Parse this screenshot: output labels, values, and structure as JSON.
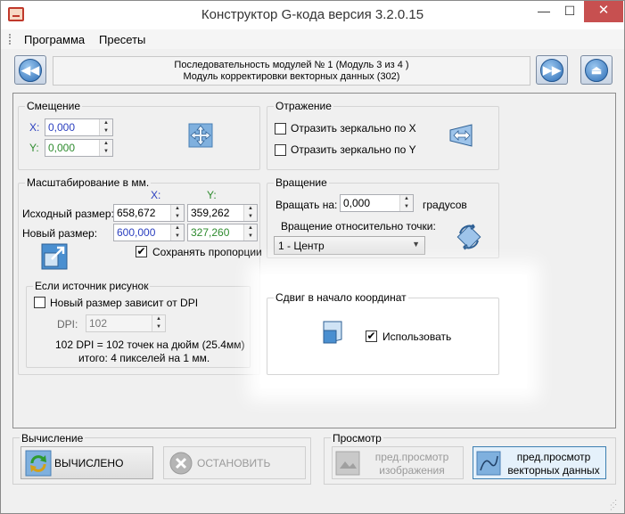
{
  "window": {
    "title": "Конструктор G-кода версия 3.2.0.15",
    "controls": {
      "minimize": "—",
      "maximize": "☐",
      "close": "✕"
    }
  },
  "menu": {
    "items": [
      "Программа",
      "Пресеты"
    ]
  },
  "sequence": {
    "line1": "Последовательность модулей № 1 (Модуль 3 из 4 )",
    "line2": "Модуль корректировки векторных данных (302)",
    "prev_icon": "rewind-icon",
    "next_icon": "fast-forward-icon",
    "eject_icon": "eject-icon"
  },
  "offset": {
    "title": "Смещение",
    "x_label": "X:",
    "x_value": "0,000",
    "y_label": "Y:",
    "y_value": "0,000",
    "icon": "move-arrows-icon"
  },
  "scaling": {
    "title": "Масштабирование в мм.",
    "col_x": "X:",
    "col_y": "Y:",
    "source_label": "Исходный размер:",
    "source_x": "658,672",
    "source_y": "359,262",
    "new_label": "Новый размер:",
    "new_x": "600,000",
    "new_y": "327,260",
    "keep_proportions": "Сохранять пропорции",
    "keep_proportions_checked": true,
    "icon": "resize-icon"
  },
  "image_source": {
    "title": "Если источник рисунок",
    "dpi_check_label": "Новый размер зависит от DPI",
    "dpi_check_checked": false,
    "dpi_label": "DPI:",
    "dpi_value": "102",
    "info_line1": "102 DPI = 102 точек на дюйм (25.4мм)",
    "info_line2": "итого: 4 пикселей на 1 мм."
  },
  "mirror": {
    "title": "Отражение",
    "mirror_x": "Отразить зеркально по X",
    "mirror_y": "Отразить зеркально по Y",
    "icon": "mirror-icon"
  },
  "rotation": {
    "title": "Вращение",
    "rotate_label": "Вращать на:",
    "rotate_value": "0,000",
    "unit": "градусов",
    "point_label": "Вращение относительно точки:",
    "point_value": "1 - Центр",
    "icon": "rotate-icon"
  },
  "origin_shift": {
    "title": "Сдвиг в начало координат",
    "use_label": "Использовать",
    "use_checked": true,
    "icon": "origin-shift-icon"
  },
  "calculation": {
    "title": "Вычисление",
    "calc_button": "ВЫЧИСЛЕНО",
    "stop_button": "ОСТАНОВИТЬ"
  },
  "preview": {
    "title": "Просмотр",
    "image_preview_line1": "пред.просмотр",
    "image_preview_line2": "изображения",
    "vector_preview_line1": "пред.просмотр",
    "vector_preview_line2": "векторных данных"
  },
  "colors": {
    "title_bg": "#ffffff",
    "form_bg": "#f0f0f0",
    "close_btn": "#c75050",
    "x_value_color": "#2b3fbf",
    "y_value_color": "#2e8b2e",
    "active_button_border": "#3c7fb1"
  }
}
